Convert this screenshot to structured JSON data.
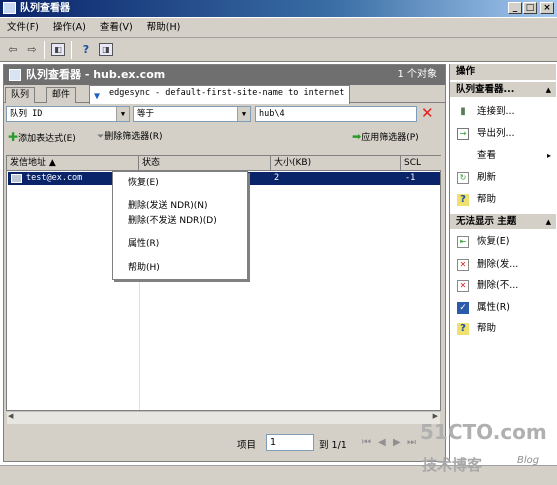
{
  "window": {
    "title": "队列查看器",
    "buttons": {
      "minimize": "_",
      "maximize": "□",
      "close": "×"
    }
  },
  "menu": [
    "文件(F)",
    "操作(A)",
    "查看(V)",
    "帮助(H)"
  ],
  "pane": {
    "title": "队列查看器 - hub.ex.com",
    "count": "1 个对象"
  },
  "tabs": [
    "队列",
    "邮件",
    "edgesync - default-first-site-name to internet"
  ],
  "filter": {
    "field": "队列 ID",
    "operator": "等于",
    "value": "hub\\4"
  },
  "actions": {
    "add_expression": "添加表达式(E)",
    "remove_filter": "删除筛选器(R)",
    "apply_filter": "应用筛选器(P)"
  },
  "columns": [
    "发信地址 ▲",
    "状态",
    "大小(KB)",
    "SCL"
  ],
  "rows": [
    {
      "from": "test@ex.com",
      "status": "",
      "size": "2",
      "scl": "-1"
    }
  ],
  "context_menu": [
    "恢复(E)",
    "删除(发送 NDR)(N)",
    "删除(不发送 NDR)(D)",
    "属性(R)",
    "帮助(H)"
  ],
  "pager": {
    "label": "项目",
    "value": "1",
    "range": "到 1/1"
  },
  "right_pane": {
    "header": "操作",
    "section1": "队列查看器...",
    "section1_items": [
      {
        "icon": "connect-icon",
        "label": "连接到..."
      },
      {
        "icon": "export-icon",
        "label": "导出列..."
      },
      {
        "icon": "view-icon",
        "label": "查看",
        "sub": "▸"
      },
      {
        "icon": "refresh-icon",
        "label": "刷新"
      },
      {
        "icon": "help-icon",
        "label": "帮助"
      }
    ],
    "section2": "无法显示 主题",
    "section2_items": [
      {
        "icon": "resume-icon",
        "label": "恢复(E)"
      },
      {
        "icon": "delete-ndr-icon",
        "label": "删除(发..."
      },
      {
        "icon": "delete-no-ndr-icon",
        "label": "删除(不..."
      },
      {
        "icon": "properties-icon",
        "label": "属性(R)"
      },
      {
        "icon": "help-icon",
        "label": "帮助"
      }
    ]
  },
  "watermark": {
    "line1": "51CTO.com",
    "line2": "技术博客",
    "line3": "Blog"
  }
}
